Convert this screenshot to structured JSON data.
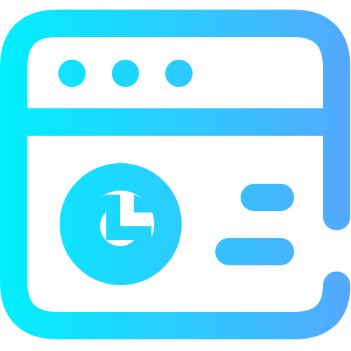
{
  "icon": {
    "name": "browser-window-analytics-icon",
    "gradient_start": "#00F0FF",
    "gradient_end": "#55A8FF"
  }
}
